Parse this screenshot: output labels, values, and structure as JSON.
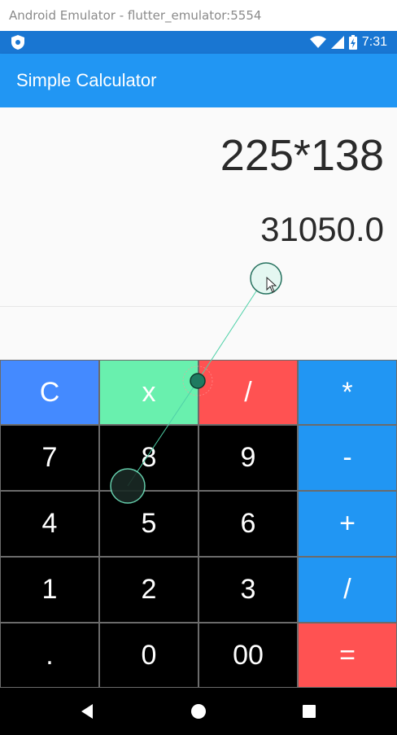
{
  "window": {
    "title": "Android Emulator - flutter_emulator:5554"
  },
  "status_bar": {
    "time": "7:31"
  },
  "app_bar": {
    "title": "Simple Calculator"
  },
  "display": {
    "expression": "225*138",
    "result": "31050.0"
  },
  "keypad": {
    "rows": [
      [
        {
          "label": "C",
          "color": "#448aff"
        },
        {
          "label": "x",
          "color": "#69f0ae"
        },
        {
          "label": "/",
          "color": "#ff5252"
        },
        {
          "label": "*",
          "color": "#2196f3"
        }
      ],
      [
        {
          "label": "7",
          "color": "#000000"
        },
        {
          "label": "8",
          "color": "#000000"
        },
        {
          "label": "9",
          "color": "#000000"
        },
        {
          "label": "-",
          "color": "#2196f3"
        }
      ],
      [
        {
          "label": "4",
          "color": "#000000"
        },
        {
          "label": "5",
          "color": "#000000"
        },
        {
          "label": "6",
          "color": "#000000"
        },
        {
          "label": "+",
          "color": "#2196f3"
        }
      ],
      [
        {
          "label": "1",
          "color": "#000000"
        },
        {
          "label": "2",
          "color": "#000000"
        },
        {
          "label": "3",
          "color": "#000000"
        },
        {
          "label": "/",
          "color": "#2196f3"
        }
      ],
      [
        {
          "label": ".",
          "color": "#000000"
        },
        {
          "label": "0",
          "color": "#000000"
        },
        {
          "label": "00",
          "color": "#000000"
        },
        {
          "label": "=",
          "color": "#ff5252"
        }
      ]
    ]
  },
  "nav_bar": {
    "buttons": [
      "back-icon",
      "home-icon",
      "recents-icon"
    ]
  },
  "colors": {
    "status_bar": "#1976d2",
    "app_bar": "#2196f3",
    "display_bg": "#fafafa"
  }
}
